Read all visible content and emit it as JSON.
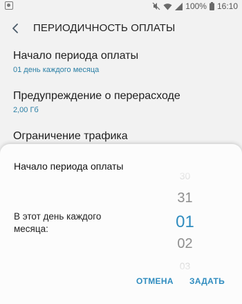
{
  "status_bar": {
    "battery_percent": "100%",
    "time": "16:10",
    "icons": [
      "notification-icon",
      "mute-icon",
      "wifi-icon",
      "signal-icon",
      "battery-icon"
    ]
  },
  "header": {
    "back_icon": "back-arrow-icon",
    "title": "ПЕРИОДИЧНОСТЬ ОПЛАТЫ"
  },
  "settings": {
    "items": [
      {
        "title": "Начало периода оплаты",
        "subtitle": "01 день каждого месяца"
      },
      {
        "title": "Предупреждение о перерасходе",
        "subtitle": "2,00 Гб"
      },
      {
        "title": "Ограничение трафика",
        "subtitle": ""
      }
    ]
  },
  "dialog": {
    "title": "Начало периода оплаты",
    "label": "В этот день каждого месяца:",
    "picker": {
      "values": [
        "30",
        "31",
        "01",
        "02",
        "03"
      ],
      "selected": "01"
    },
    "cancel_label": "ОТМЕНА",
    "set_label": "ЗАДАТЬ"
  },
  "colors": {
    "accent": "#2f8cbf",
    "subtitle": "#2b7fa5",
    "background": "#f2f2f2"
  }
}
